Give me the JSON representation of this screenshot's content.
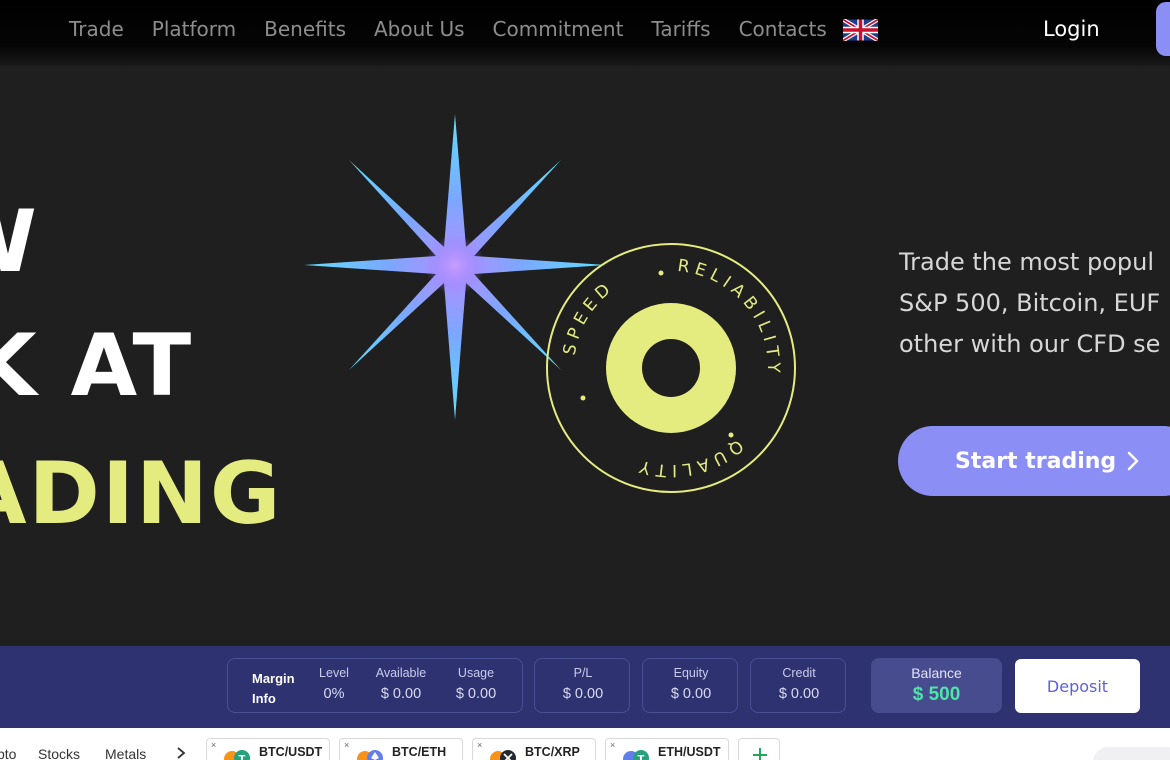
{
  "nav": {
    "links": [
      "Trade",
      "Platform",
      "Benefits",
      "About Us",
      "Commitment",
      "Tariffs",
      "Contacts"
    ],
    "language_flag": "uk-flag-icon",
    "login": "Login"
  },
  "hero": {
    "headline": [
      "W",
      "K AT",
      "ADING"
    ],
    "badge_words": [
      "SPEED",
      "RELIABILITY",
      "QUALITY"
    ],
    "tagline": [
      "Trade the most popul",
      "S&P 500, Bitcoin, EUF",
      "other with our CFD se"
    ],
    "cta": "Start trading",
    "colors": {
      "accent": "#8b8ff5",
      "lime": "#e4ec7f",
      "bg": "#1f1f1f"
    }
  },
  "account": {
    "margin_label_1": "Margin",
    "margin_label_2": "Info",
    "margin": [
      {
        "title": "Level",
        "value": "0%"
      },
      {
        "title": "Available",
        "value": "$ 0.00"
      },
      {
        "title": "Usage",
        "value": "$ 0.00"
      }
    ],
    "pl": {
      "title": "P/L",
      "value": "$ 0.00"
    },
    "equity": {
      "title": "Equity",
      "value": "$ 0.00"
    },
    "credit": {
      "title": "Credit",
      "value": "$ 0.00"
    },
    "balance": {
      "title": "Balance",
      "value": "$ 500"
    },
    "deposit": "Deposit"
  },
  "market": {
    "categories": [
      "pto",
      "Stocks",
      "Metals"
    ],
    "pairs": [
      "BTC/USDT",
      "BTC/ETH",
      "BTC/XRP",
      "ETH/USDT"
    ],
    "close_symbol": "×"
  }
}
